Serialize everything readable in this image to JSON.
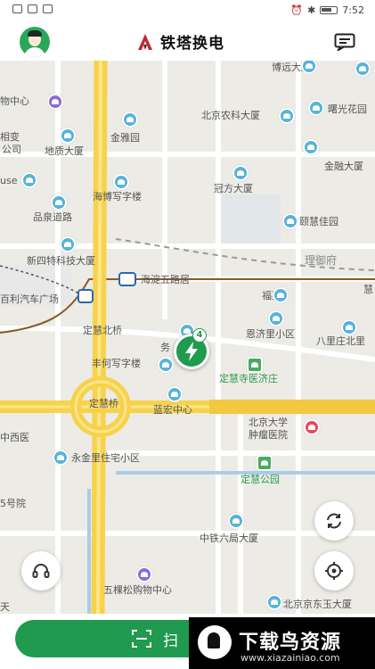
{
  "status_bar": {
    "time": "7:52"
  },
  "header": {
    "title": "铁塔换电",
    "avatar": "user-avatar",
    "message_icon": "chat-icon"
  },
  "map": {
    "labels": [
      "博远大厦",
      "物中心",
      "北京农科大厦",
      "曙光花园",
      "相变",
      "金雅园",
      "公司",
      "地质大厦",
      "金融大厦",
      "use",
      "海博写字楼",
      "冠方大厦",
      "品泉道路",
      "颐慧佳园",
      "新四特科技大厦",
      "理御府",
      "海淀五路居",
      "慧",
      "福苑",
      "百利汽车广场",
      "定慧北桥",
      "恩济里小区",
      "八里庄北里",
      "务",
      "丰何写字楼",
      "定慧寺医济庄",
      "定慧桥",
      "蓝宏中心",
      "北京大学",
      "肿瘤医院",
      "中西医",
      "永金里住宅小区",
      "5号院",
      "定慧公园",
      "中铁六局大厦",
      "五棵松购物中心",
      "北京京东玉大厦",
      "天"
    ],
    "station_count": "4",
    "icons": {
      "refresh": "refresh-icon",
      "locate": "locate-icon",
      "support": "headset-icon"
    }
  },
  "bottom": {
    "scan_label": "扫",
    "scan_icon": "scan-icon"
  },
  "watermark": {
    "title": "下载鸟资源",
    "url": "www.xiazainiao.com"
  }
}
